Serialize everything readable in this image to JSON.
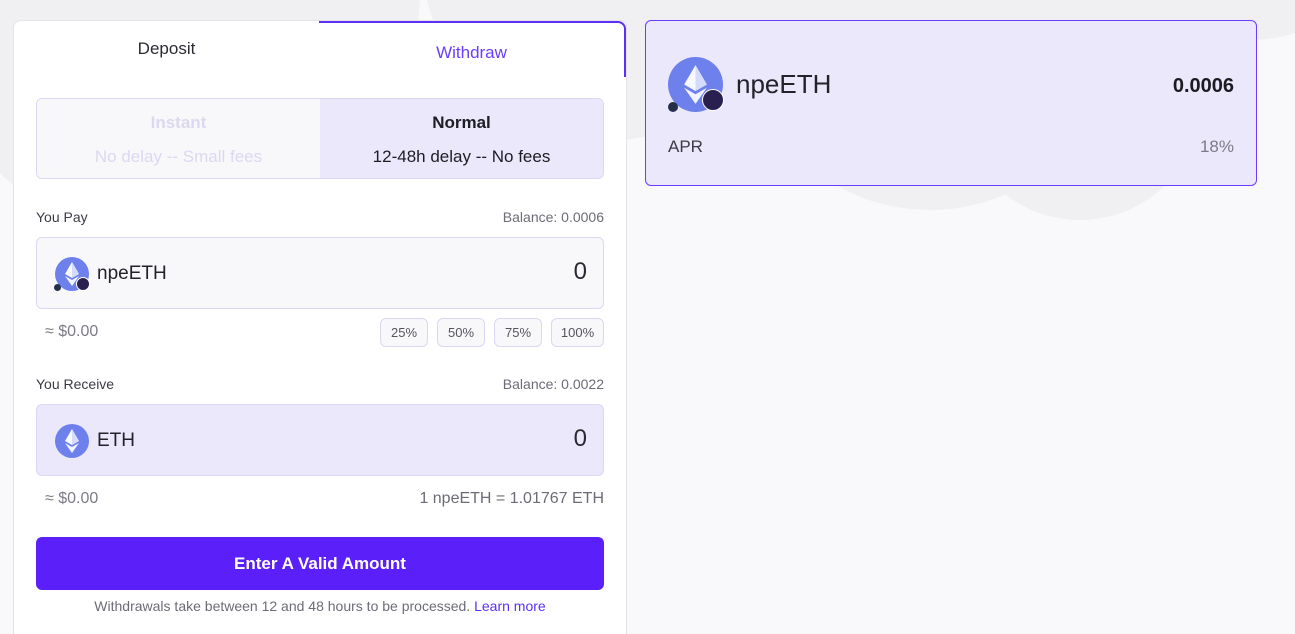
{
  "tabs": {
    "deposit": "Deposit",
    "withdraw": "Withdraw"
  },
  "mode": {
    "instant": {
      "title": "Instant",
      "subtitle": "No delay -- Small fees"
    },
    "normal": {
      "title": "Normal",
      "subtitle": "12-48h delay -- No fees"
    }
  },
  "pay": {
    "label": "You Pay",
    "balance": "Balance: 0.0006",
    "token": "npeETH",
    "token_icon": "npeeth-icon",
    "amount": "0",
    "usd": "≈ $0.00",
    "percents": [
      "25%",
      "50%",
      "75%",
      "100%"
    ]
  },
  "receive": {
    "label": "You Receive",
    "balance": "Balance: 0.0022",
    "token": "ETH",
    "token_icon": "eth-icon",
    "amount": "0",
    "usd": "≈ $0.00",
    "rate": "1 npeETH = 1.01767 ETH"
  },
  "cta": {
    "label": "Enter A Valid Amount"
  },
  "note": {
    "text": "Withdrawals take between 12 and 48 hours to be processed.",
    "link": "Learn more"
  },
  "card": {
    "token": "npeETH",
    "balance": "0.0006",
    "apr_label": "APR",
    "apr_value": "18%"
  },
  "colors": {
    "accent": "#5b1ffa",
    "selected_bg": "#ebe8fb",
    "eth_blue": "#6d80ec"
  }
}
